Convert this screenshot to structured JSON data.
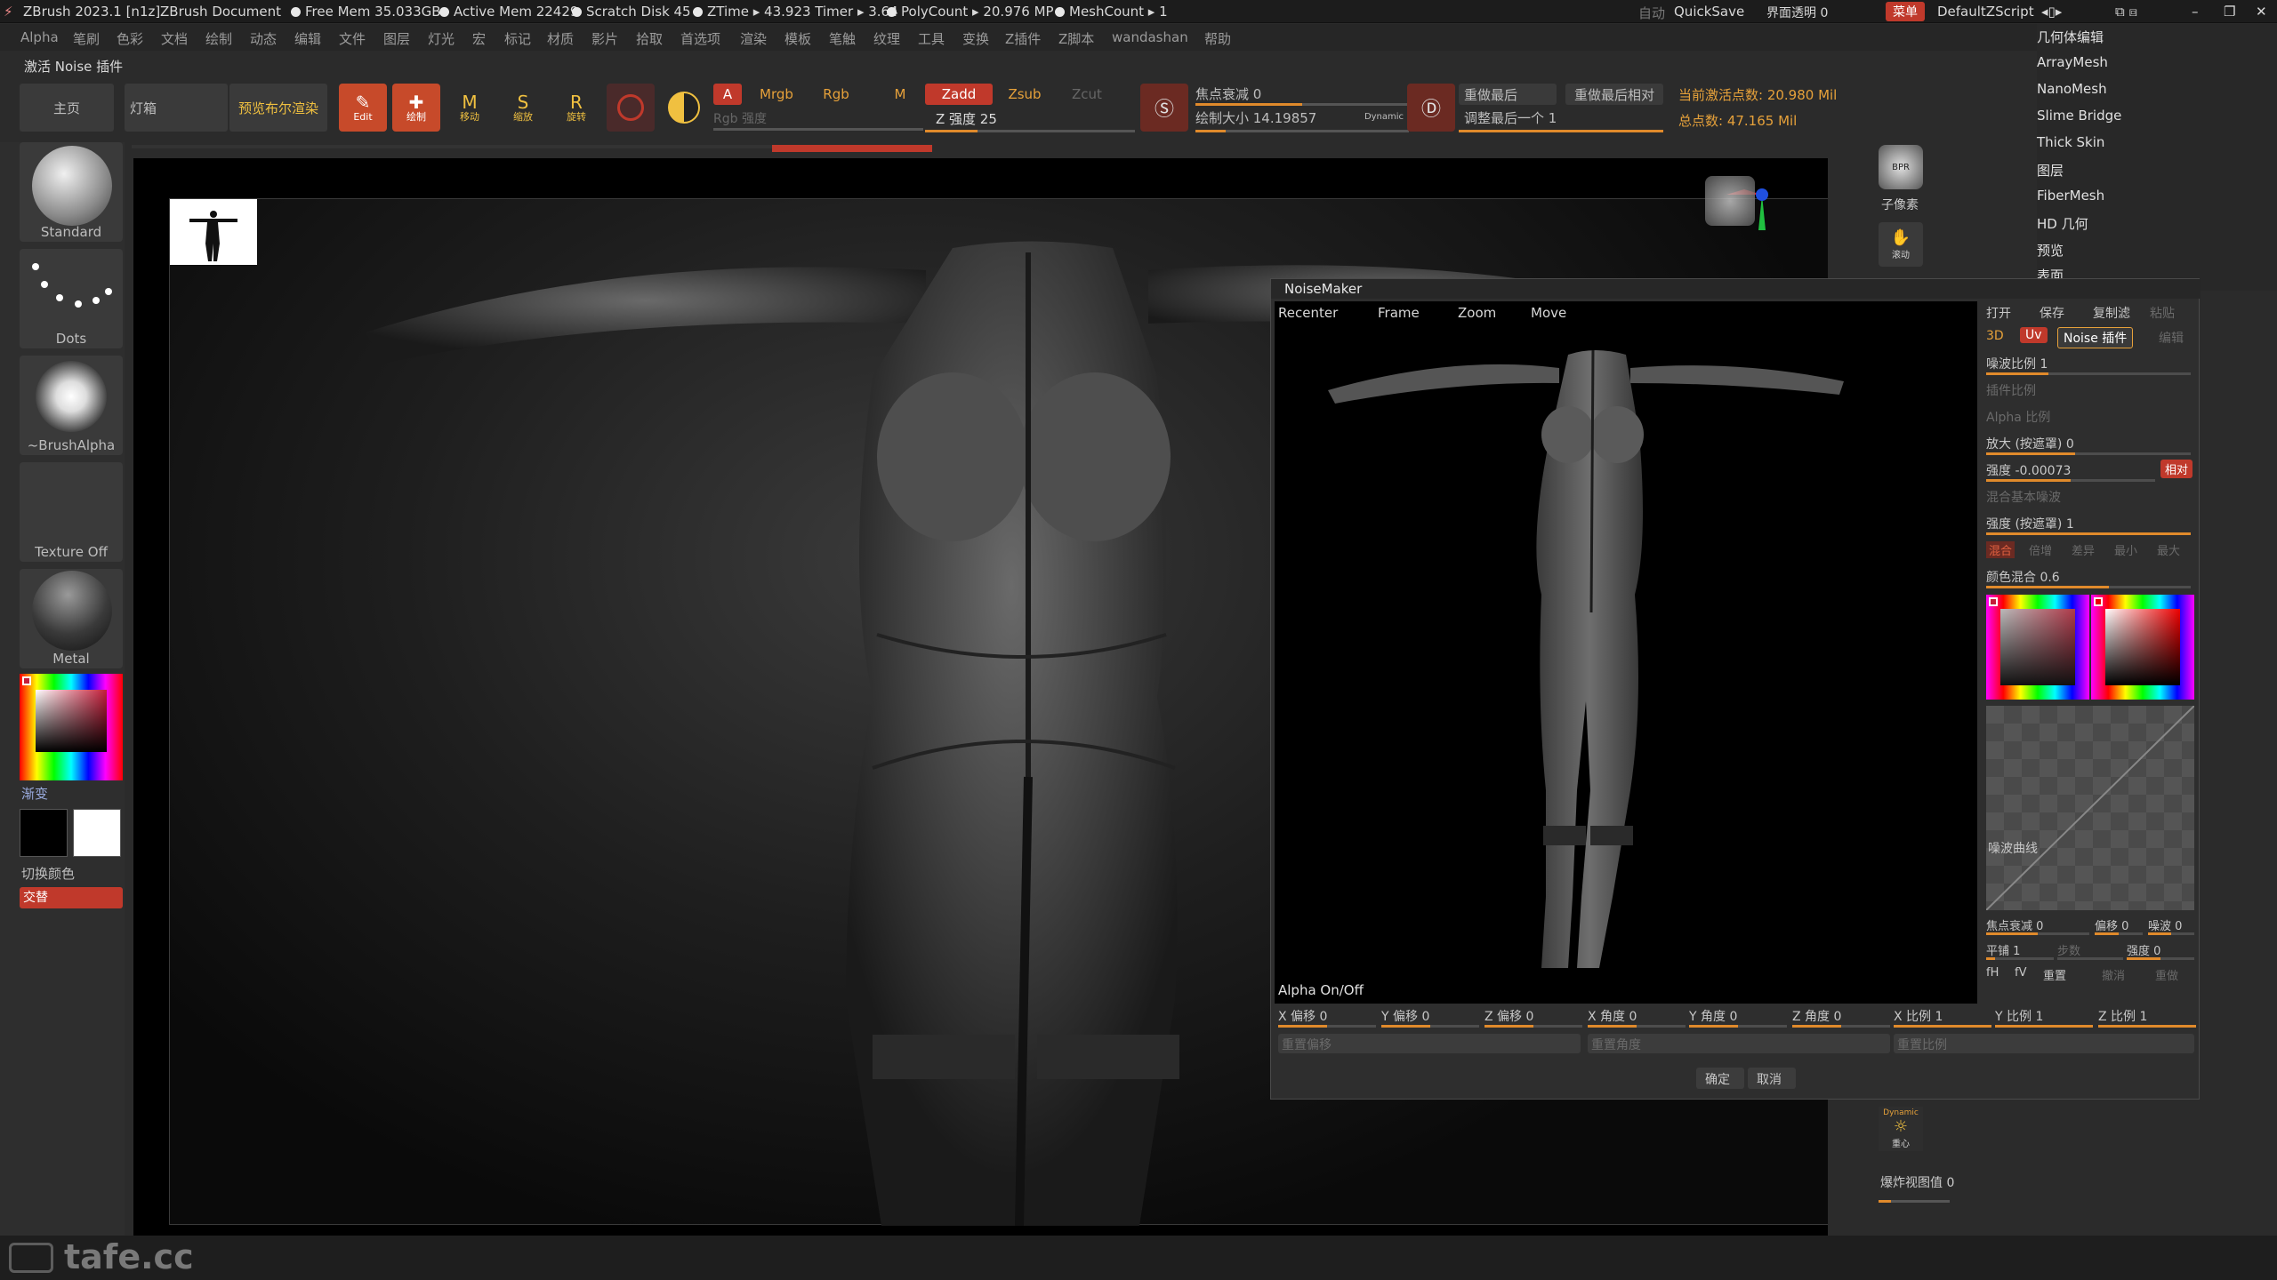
{
  "titlebar": {
    "app": "ZBrush 2023.1 [n1z]",
    "doc": "ZBrush Document",
    "free_mem": "Free Mem 35.033GB",
    "active_mem": "Active Mem 22429",
    "scratch": "Scratch Disk 45",
    "ztime": "ZTime ▸ 43.923  Timer ▸ 3.64",
    "polycount": "PolyCount ▸ 20.976 MP",
    "meshcount": "MeshCount ▸ 1",
    "auto": "自动",
    "quicksave": "QuickSave",
    "opacity": "界面透明 0",
    "menu": "菜单",
    "script": "DefaultZScript"
  },
  "menu": [
    "Alpha",
    "笔刷",
    "色彩",
    "文档",
    "绘制",
    "动态",
    "编辑",
    "文件",
    "图层",
    "灯光",
    "宏",
    "标记",
    "材质",
    "影片",
    "拾取",
    "首选项",
    "渲染",
    "模板",
    "笔触",
    "纹理",
    "工具",
    "变换",
    "Z插件",
    "Z脚本",
    "wandashan",
    "帮助"
  ],
  "status_label": "激活 Noise 插件",
  "toolbar": {
    "home": "主页",
    "lightbox": "灯箱",
    "bpr": "预览布尔渲染",
    "edit": "Edit",
    "draw": "绘制",
    "move": "移动",
    "scale": "缩放",
    "rotate": "旋转",
    "a": "A",
    "mrgb": "Mrgb",
    "rgb": "Rgb",
    "m": "M",
    "zadd": "Zadd",
    "zsub": "Zsub",
    "zcut": "Zcut",
    "rgb_intensity": "Rgb 强度",
    "z_intensity": "Z 强度 25",
    "focal": "焦点衰减 0",
    "draw_size": "绘制大小 14.19857",
    "dynamic": "Dynamic",
    "redo_last": "重做最后",
    "redo_last_rel": "重做最后相对",
    "adjust_last": "调整最后一个 1",
    "active_points": "当前激活点数: 20.980 Mil",
    "total_points": "总点数: 47.165 Mil"
  },
  "toolbar_values": {
    "z_intensity": 0.25,
    "focal": 0.5,
    "draw_size": 0.14,
    "adjust_last": 1.0
  },
  "leftshelf": {
    "brush": "Standard",
    "stroke": "Dots",
    "alpha": "~BrushAlpha",
    "texture": "Texture Off",
    "material": "Metal",
    "gradient": "渐变",
    "switch_color": "切换颜色",
    "swap": "交替"
  },
  "rightstrip": {
    "bpr": "BPR",
    "subpixel": "子像素",
    "scroll": "滚动",
    "dynamic": "Dynamic",
    "persp": "重心",
    "floor_value": "爆炸视图值 0"
  },
  "rightmenu": [
    "几何体编辑",
    "ArrayMesh",
    "NanoMesh",
    "Slime Bridge",
    "Thick Skin",
    "图层",
    "FiberMesh",
    "HD 几何",
    "预览",
    "表面"
  ],
  "noisemaker": {
    "title": "NoiseMaker",
    "tabs": [
      "Recenter",
      "Frame",
      "Zoom",
      "Move"
    ],
    "alpha_toggle": "Alpha On/Off",
    "open": "打开",
    "save": "保存",
    "copy": "复制滤",
    "paste": "粘贴",
    "mode_3d": "3D",
    "mode_uv": "Uv",
    "plugin": "Noise 插件",
    "edit": "编辑",
    "noise_scale": "噪波比例 1",
    "plugin_scale": "插件比例",
    "alpha_scale": "Alpha 比例",
    "magnify": "放大 (按遮罩)  0",
    "strength": "强度 -0.00073",
    "relative": "相对",
    "mix_base": "混合基本噪波",
    "strength_mask": "强度 (按遮罩)  1",
    "blend_modes": [
      "混合",
      "倍增",
      "差异",
      "最小",
      "最大"
    ],
    "color_blend": "颜色混合 0.6",
    "noise_curve": "噪波曲线",
    "focal_shift": "焦点衰减 0",
    "offset": "偏移 0",
    "noise_val": "噪波 0",
    "tile": "平铺 1",
    "steps": "步数",
    "intensity": "强度 0",
    "fh": "fH",
    "fv": "fV",
    "reset": "重置",
    "undo": "撤消",
    "redo": "重做",
    "x_offset": "X 偏移 0",
    "y_offset": "Y 偏移 0",
    "z_offset": "Z 偏移 0",
    "x_angle": "X 角度 0",
    "y_angle": "Y 角度 0",
    "z_angle": "Z 角度 0",
    "x_scale": "X 比例 1",
    "y_scale": "Y 比例 1",
    "z_scale": "Z 比例 1",
    "reset_offset": "重置偏移",
    "reset_angle": "重置角度",
    "reset_scale": "重置比例",
    "ok": "确定",
    "cancel": "取消"
  },
  "watermark": "tafe.cc",
  "colors": {
    "accent": "#e08a2b",
    "red": "#c0392b",
    "active_points": "#e6a13a"
  }
}
